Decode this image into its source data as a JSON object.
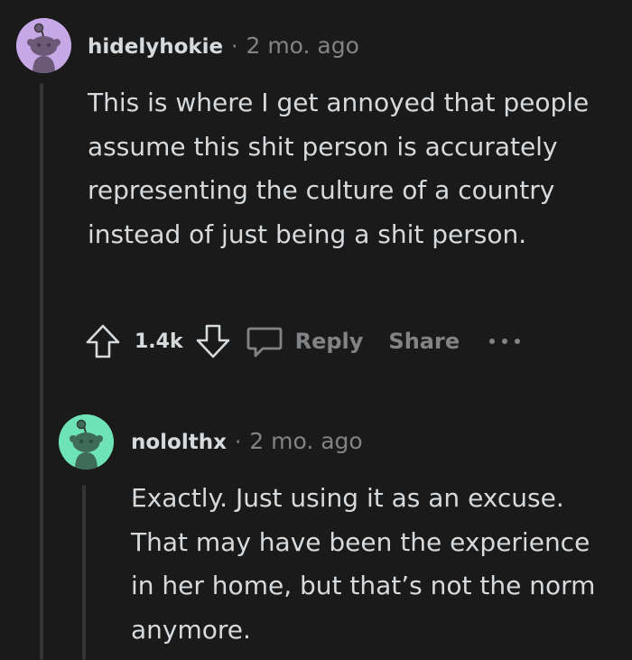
{
  "comments": [
    {
      "username": "hidelyhokie",
      "separator": "·",
      "timestamp": "2 mo. ago",
      "avatar_color": "#c7a8e6",
      "avatar_icon": "snoo-avatar-icon",
      "body": "This is where I get annoyed that people assume this shit person is accurately representing the culture of a country instead of just being a shit person.",
      "actions": {
        "upvote_icon": "upvote-arrow-icon",
        "score": "1.4k",
        "downvote_icon": "downvote-arrow-icon",
        "reply_icon": "comment-bubble-icon",
        "reply_label": "Reply",
        "share_label": "Share",
        "more_icon": "ellipsis-icon"
      }
    },
    {
      "username": "nololthx",
      "separator": "·",
      "timestamp": "2 mo. ago",
      "avatar_color": "#6fe3b8",
      "avatar_icon": "snoo-avatar-icon",
      "body": "Exactly. Just using it as an excuse. That may have been the experience in her home, but that’s not the norm anymore."
    }
  ],
  "colors": {
    "background": "#1a1a1b",
    "text_primary": "#d7dadc",
    "text_muted": "#818384",
    "thread_line": "#343536"
  }
}
